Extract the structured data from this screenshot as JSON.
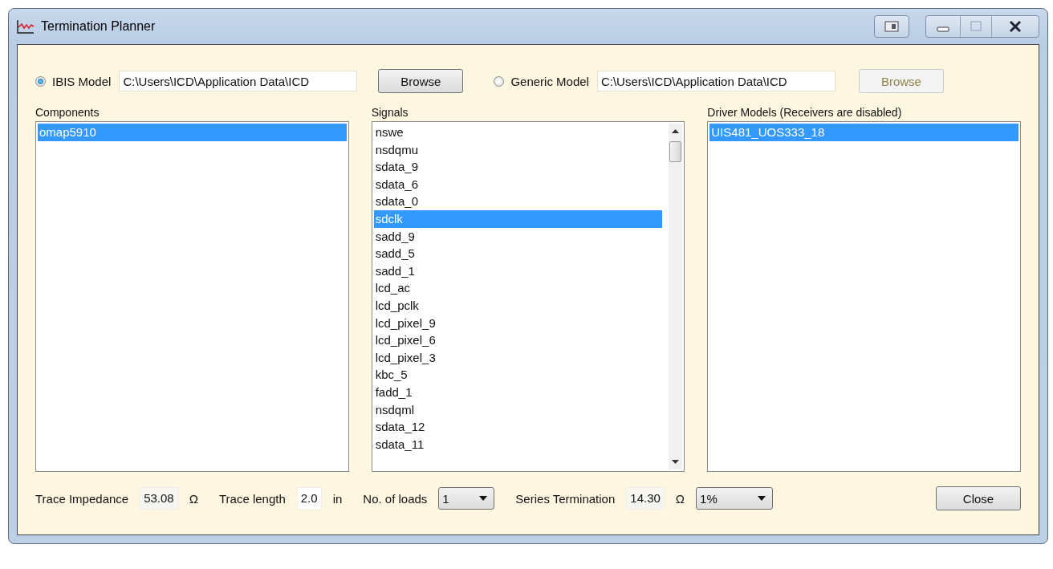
{
  "window": {
    "title": "Termination Planner"
  },
  "model_sources": [
    {
      "label": "IBIS Model",
      "selected": true,
      "path": "C:\\Users\\ICD\\Application Data\\ICD",
      "browse": {
        "label": "Browse",
        "disabled": false
      }
    },
    {
      "label": "Generic Model",
      "selected": false,
      "path": "C:\\Users\\ICD\\Application Data\\ICD",
      "browse": {
        "label": "Browse",
        "disabled": true
      }
    }
  ],
  "lists": [
    {
      "title": "Components",
      "scrollable": false,
      "items": [
        {
          "label": "omap5910",
          "selected": true
        }
      ]
    },
    {
      "title": "Signals",
      "scrollable": true,
      "items": [
        {
          "label": "nswe",
          "selected": false
        },
        {
          "label": "nsdqmu",
          "selected": false
        },
        {
          "label": "sdata_9",
          "selected": false
        },
        {
          "label": "sdata_6",
          "selected": false
        },
        {
          "label": "sdata_0",
          "selected": false
        },
        {
          "label": "sdclk",
          "selected": true
        },
        {
          "label": "sadd_9",
          "selected": false
        },
        {
          "label": "sadd_5",
          "selected": false
        },
        {
          "label": "sadd_1",
          "selected": false
        },
        {
          "label": "lcd_ac",
          "selected": false
        },
        {
          "label": "lcd_pclk",
          "selected": false
        },
        {
          "label": "lcd_pixel_9",
          "selected": false
        },
        {
          "label": "lcd_pixel_6",
          "selected": false
        },
        {
          "label": "lcd_pixel_3",
          "selected": false
        },
        {
          "label": "kbc_5",
          "selected": false
        },
        {
          "label": "fadd_1",
          "selected": false
        },
        {
          "label": "nsdqml",
          "selected": false
        },
        {
          "label": "sdata_12",
          "selected": false
        },
        {
          "label": "sdata_11",
          "selected": false
        }
      ]
    },
    {
      "title": "Driver Models (Receivers are disabled)",
      "scrollable": false,
      "items": [
        {
          "label": "UIS481_UOS333_18",
          "selected": true
        }
      ]
    }
  ],
  "bottom_bar": [
    {
      "kind": "label",
      "text": "Trace Impedance"
    },
    {
      "kind": "field",
      "value": "53.08",
      "readonly": true
    },
    {
      "kind": "unit",
      "text": "Ω"
    },
    {
      "kind": "label",
      "text": "Trace length"
    },
    {
      "kind": "field",
      "value": "2.0",
      "readonly": false
    },
    {
      "kind": "unit",
      "text": "in"
    },
    {
      "kind": "label",
      "text": "No. of loads"
    },
    {
      "kind": "combo",
      "value": "1"
    },
    {
      "kind": "label",
      "text": "Series Termination"
    },
    {
      "kind": "field",
      "value": "14.30",
      "readonly": true
    },
    {
      "kind": "unit",
      "text": "Ω"
    },
    {
      "kind": "combo",
      "value": "1%"
    },
    {
      "kind": "button",
      "text": "Close"
    }
  ]
}
